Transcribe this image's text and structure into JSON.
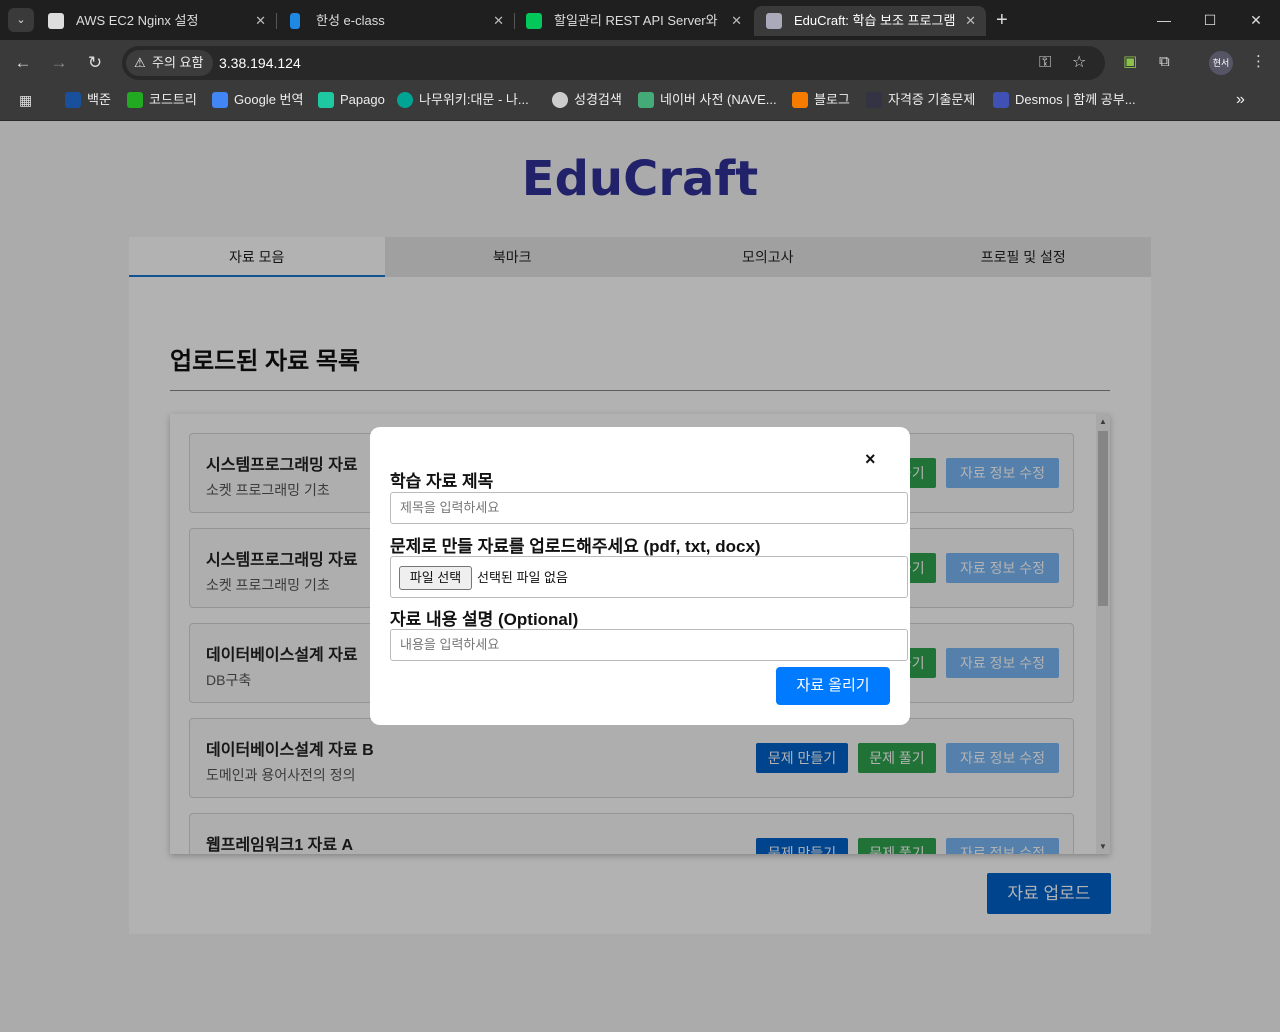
{
  "browser": {
    "tabs": [
      {
        "title": "AWS EC2 Nginx 설정",
        "active": false
      },
      {
        "title": "한성 e-class",
        "active": false
      },
      {
        "title": "할일관리 REST API Server와 Cl",
        "active": false
      },
      {
        "title": "EduCraft: 학습 보조 프로그램",
        "active": true
      }
    ],
    "security_label": "주의 요함",
    "url": "3.38.194.124",
    "profile": "현서",
    "bookmarks": [
      "백준",
      "코드트리",
      "Google 번역",
      "Papago",
      "나무위키:대문 - 나...",
      "성경검색",
      "네이버 사전 (NAVE...",
      "블로그",
      "자격증 기출문제",
      "Desmos | 함께 공부..."
    ]
  },
  "app": {
    "brand": "EduCraft",
    "nav": [
      "자료 모음",
      "북마크",
      "모의고사",
      "프로필 및 설정"
    ],
    "section_title": "업로드된 자료 목록",
    "materials": [
      {
        "title": "시스템프로그래밍 자료",
        "desc": "소켓 프로그래밍 기초"
      },
      {
        "title": "시스템프로그래밍 자료",
        "desc": "소켓 프로그래밍 기초"
      },
      {
        "title": "데이터베이스설계 자료",
        "desc": "DB구축"
      },
      {
        "title": "데이터베이스설계 자료 B",
        "desc": "도메인과 용어사전의 정의"
      },
      {
        "title": "웹프레임워크1 자료 A",
        "desc": ""
      }
    ],
    "buttons": {
      "make": "문제 만들기",
      "solve": "문제 풀기",
      "edit": "자료 정보 수정",
      "upload": "자료 업로드"
    }
  },
  "modal": {
    "close": "×",
    "title_label": "학습 자료 제목",
    "title_placeholder": "제목을 입력하세요",
    "file_label": "문제로 만들 자료를 업로드해주세요 (pdf, txt, docx)",
    "file_button": "파일 선택",
    "file_status": "선택된 파일 없음",
    "desc_label": "자료 내용 설명 (Optional)",
    "desc_placeholder": "내용을 입력하세요",
    "submit": "자료 올리기"
  }
}
